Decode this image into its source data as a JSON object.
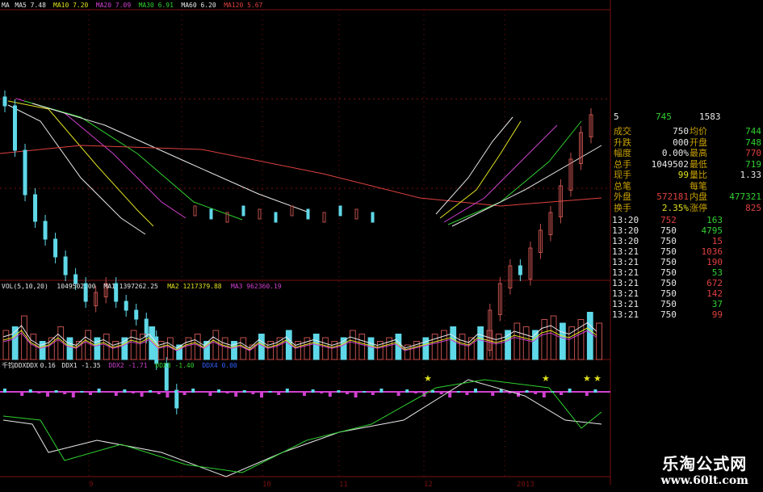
{
  "colors": {
    "up": "#c0504d",
    "down": "#5fd8e8",
    "white": "#e8e8e8",
    "yellow": "#e0e020",
    "green": "#30d030",
    "red": "#e04040",
    "magenta": "#d040d0",
    "grid": "#7a1010"
  },
  "ma_legend": [
    {
      "label": "MA",
      "color": "#e8e8e8"
    },
    {
      "label": "MA5 7.48",
      "color": "#e8e8e8"
    },
    {
      "label": "MA10 7.20",
      "color": "#e0e020"
    },
    {
      "label": "MA20 7.09",
      "color": "#d040d0"
    },
    {
      "label": "MA30 6.91",
      "color": "#30d030"
    },
    {
      "label": "MA60 6.20",
      "color": "#e8e8e8"
    },
    {
      "label": "MA120 5.67",
      "color": "#e04040"
    }
  ],
  "vol_legend": [
    {
      "label": "VOL(5,10,20)",
      "color": "#e8e8e8"
    },
    {
      "label": "1049502.00",
      "color": "#e8e8e8"
    },
    {
      "label": "MA1 1397262.25",
      "color": "#e8e8e8"
    },
    {
      "label": "MA2 1217379.88",
      "color": "#e0e020"
    },
    {
      "label": "MA3 962360.19",
      "color": "#d040d0"
    }
  ],
  "ddx_legend": [
    {
      "label": "千钧DDXDDX",
      "color": "#e8e8e8"
    },
    {
      "label": "0.16",
      "color": "#e8e8e8"
    },
    {
      "label": "DDX1 -1.35",
      "color": "#e8e8e8"
    },
    {
      "label": "DDX2 -1.71",
      "color": "#d040d0"
    },
    {
      "label": "DDX3 -1.40",
      "color": "#30d030"
    },
    {
      "label": "DDX4 0.00",
      "color": "#3060ff"
    }
  ],
  "x_labels": [
    "9",
    "10",
    "11",
    "12",
    "2013"
  ],
  "chart_data": [
    {
      "type": "candlestick",
      "title": "MA",
      "series": [
        {
          "name": "MA5",
          "last": 7.48
        },
        {
          "name": "MA10",
          "last": 7.2
        },
        {
          "name": "MA20",
          "last": 7.09
        },
        {
          "name": "MA30",
          "last": 6.91
        },
        {
          "name": "MA60",
          "last": 6.2
        },
        {
          "name": "MA120",
          "last": 5.67
        }
      ],
      "close": [
        7.9,
        7.4,
        6.9,
        6.6,
        6.4,
        6.2,
        6.0,
        5.9,
        5.7,
        5.8,
        5.9,
        5.7,
        5.6,
        5.5,
        5.3,
        5.0,
        4.7,
        4.5,
        null,
        null,
        null,
        null,
        null,
        null,
        null,
        null,
        null,
        null,
        null,
        null,
        null,
        null,
        null,
        null,
        null,
        null,
        null,
        null,
        null,
        null,
        null,
        null,
        null,
        null,
        null,
        null,
        null,
        5.2,
        5.6,
        5.9,
        6.1,
        6.0,
        6.3,
        6.5,
        6.7,
        7.0,
        7.3,
        7.6,
        7.8
      ]
    },
    {
      "type": "bar",
      "title": "VOL(5,10,20)",
      "series": [
        {
          "name": "VOL",
          "last": 1049502.0
        },
        {
          "name": "MA1",
          "last": 1397262.25
        },
        {
          "name": "MA2",
          "last": 1217379.88
        },
        {
          "name": "MA3",
          "last": 962360.19
        }
      ],
      "values": [
        40,
        45,
        60,
        35,
        25,
        30,
        45,
        30,
        25,
        40,
        30,
        35,
        25,
        30,
        40,
        35,
        45,
        25,
        30,
        20,
        30,
        35,
        25,
        40,
        30,
        25,
        30,
        20,
        35,
        25,
        30,
        40,
        25,
        30,
        35,
        30,
        25,
        30,
        40,
        35,
        30,
        25,
        30,
        35,
        20,
        25,
        30,
        35,
        40,
        45,
        35,
        30,
        45,
        40,
        35,
        40,
        50,
        45,
        40,
        55,
        60,
        50,
        45,
        55,
        65,
        50
      ]
    },
    {
      "type": "line",
      "title": "千钧DDXDDX",
      "series": [
        {
          "name": "DDX",
          "last": 0.16
        },
        {
          "name": "DDX1",
          "last": -1.35
        },
        {
          "name": "DDX2",
          "last": -1.71
        },
        {
          "name": "DDX3",
          "last": -1.4
        },
        {
          "name": "DDX4",
          "last": 0.0
        }
      ]
    }
  ],
  "quote": {
    "header": {
      "col1": "5",
      "bid": "745",
      "ask": "1583"
    },
    "stats": [
      {
        "l1": "成交",
        "v1": "750",
        "l2": "均价",
        "v2": "744",
        "c1": "#e8e8e8",
        "c2": "#30d030"
      },
      {
        "l1": "升跌",
        "v1": "000",
        "l2": "开盘",
        "v2": "748",
        "c1": "#e8e8e8",
        "c2": "#30d030"
      },
      {
        "l1": "幅度",
        "v1": "0.00%",
        "l2": "最高",
        "v2": "770",
        "c1": "#e8e8e8",
        "c2": "#e04040"
      },
      {
        "l1": "总手",
        "v1": "1049502",
        "l2": "最低",
        "v2": "719",
        "c1": "#e8e8e8",
        "c2": "#30d030"
      },
      {
        "l1": "现手",
        "v1": "99",
        "l2": "量比",
        "v2": "1.33",
        "c1": "#e0e020",
        "c2": "#e8e8e8"
      },
      {
        "l1": "总笔",
        "v1": "",
        "l2": "每笔",
        "v2": "",
        "c1": "#e8e8e8",
        "c2": "#e8e8e8"
      },
      {
        "l1": "外盘",
        "v1": "572181",
        "l2": "内盘",
        "v2": "477321",
        "c1": "#e04040",
        "c2": "#30d030"
      },
      {
        "l1": "换手",
        "v1": "2.35%",
        "l2": "涨停",
        "v2": "825",
        "c1": "#e0e020",
        "c2": "#e04040"
      }
    ],
    "ticks": [
      {
        "time": "13:20",
        "price": "752",
        "vol": "163",
        "pc": "#e04040",
        "vc": "#30d030"
      },
      {
        "time": "13:20",
        "price": "750",
        "vol": "4795",
        "pc": "#e8e8e8",
        "vc": "#30d030"
      },
      {
        "time": "13:20",
        "price": "750",
        "vol": "15",
        "pc": "#e8e8e8",
        "vc": "#e04040"
      },
      {
        "time": "13:21",
        "price": "750",
        "vol": "1036",
        "pc": "#e8e8e8",
        "vc": "#e04040"
      },
      {
        "time": "13:21",
        "price": "750",
        "vol": "190",
        "pc": "#e8e8e8",
        "vc": "#e04040"
      },
      {
        "time": "13:21",
        "price": "750",
        "vol": "53",
        "pc": "#e8e8e8",
        "vc": "#30d030"
      },
      {
        "time": "13:21",
        "price": "750",
        "vol": "672",
        "pc": "#e8e8e8",
        "vc": "#e04040"
      },
      {
        "time": "13:21",
        "price": "750",
        "vol": "142",
        "pc": "#e8e8e8",
        "vc": "#e04040"
      },
      {
        "time": "13:21",
        "price": "750",
        "vol": "37",
        "pc": "#e8e8e8",
        "vc": "#30d030"
      },
      {
        "time": "13:21",
        "price": "750",
        "vol": "99",
        "pc": "#e8e8e8",
        "vc": "#e04040"
      }
    ]
  },
  "watermark": {
    "name": "乐淘公式网",
    "url": "www.60lt.com"
  }
}
